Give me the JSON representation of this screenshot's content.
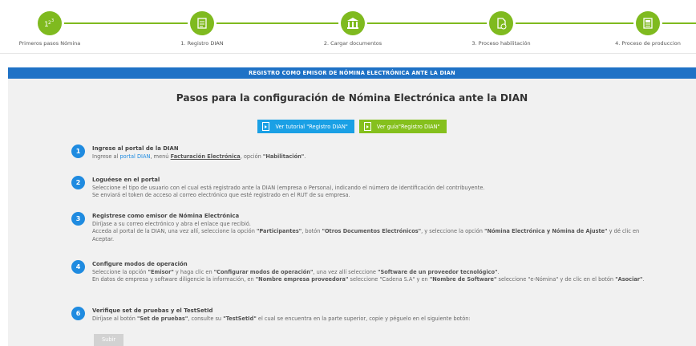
{
  "stepper": {
    "steps": [
      {
        "label": "Primeros pasos Nómina",
        "icon": "numbers-icon"
      },
      {
        "label": "1. Registro DIAN",
        "icon": "document-icon"
      },
      {
        "label": "2. Cargar documentos",
        "icon": "building-icon"
      },
      {
        "label": "3. Proceso habilitación",
        "icon": "file-check-icon"
      },
      {
        "label": "4. Proceso de produccion",
        "icon": "document-list-icon"
      }
    ],
    "accent": "#7fba1f"
  },
  "banner": "REGISTRO COMO EMISOR DE NÓMINA ELECTRÓNICA ANTE LA DIAN",
  "title": "Pasos para la configuración de Nómina Electrónica ante la DIAN",
  "buttons": {
    "tutorial": "Ver tutorial \"Registro DIAN\"",
    "guide": "Ver guía\"Registro DIAN\""
  },
  "items": [
    {
      "num": "1",
      "heading": "Ingrese al portal de la DIAN",
      "l1a": "Ingrese al ",
      "l1link": "portal DIAN",
      "l1b": ", menú ",
      "l1c": "Facturación Electrónica",
      "l1d": ", opción ",
      "l1e": "\"Habilitación\"",
      "l1f": "."
    },
    {
      "num": "2",
      "heading": "Loguéese en el portal",
      "l1": "Seleccione el tipo de usuario con el cual está registrado ante la DIAN (empresa o Persona), indicando el número de identificación del contribuyente.",
      "l2": "Se enviará el token de acceso al correo electrónico que esté registrado en el RUT de su empresa."
    },
    {
      "num": "3",
      "heading": "Registrese como emisor de Nómina Electrónica",
      "l1": "Diríjase a su correo electrónico y abra el enlace que recibió.",
      "l2a": "Acceda al portal de la DIAN, una vez allí, seleccione la opción ",
      "l2b": "\"Participantes\"",
      "l2c": ", botón ",
      "l2d": "\"Otros Documentos Electrónicos\"",
      "l2e": ", y seleccione la opción ",
      "l2f": "\"Nómina Electrónica y Nómina de Ajuste\"",
      "l2g": " y dé clic en Aceptar."
    },
    {
      "num": "4",
      "heading": "Configure modos de operación",
      "l1a": "Seleccione la opción ",
      "l1b": "\"Emisor\"",
      "l1c": " y haga clic en ",
      "l1d": "\"Configurar modos de operación\"",
      "l1e": ", una vez allí seleccione ",
      "l1f": "\"Software de un proveedor tecnológico\"",
      "l1g": ".",
      "l2a": "En datos de empresa y software diligencie la información, en ",
      "l2b": "\"Nombre empresa proveedora\"",
      "l2c": " seleccione \"Cadena S.A\" y en ",
      "l2d": "\"Nombre de Software\"",
      "l2e": " seleccione \"e-Nómina\" y de clic en el botón ",
      "l2f": "\"Asociar\"",
      "l2g": "."
    },
    {
      "num": "6",
      "heading": "Verifique set de pruebas y el TestSetId",
      "l1a": "Diríjase al botón ",
      "l1b": "\"Set de pruebas\"",
      "l1c": ", consulte su ",
      "l1d": "\"TestSetId\"",
      "l1e": " el cual se encuentra en la parte superior, copie y péguelo en el siguiente botón:"
    }
  ],
  "subir": "Subir"
}
